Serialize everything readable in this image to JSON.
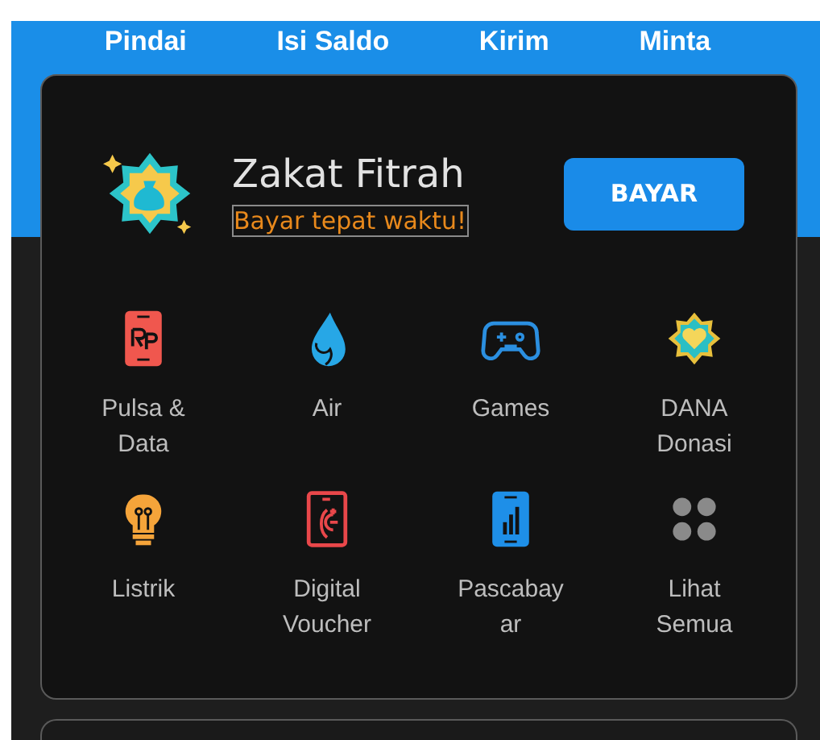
{
  "top_actions": [
    "Pindai",
    "Isi Saldo",
    "Kirim",
    "Minta"
  ],
  "promo": {
    "title": "Zakat Fitrah",
    "subtitle": "Bayar tepat waktu!",
    "button": "BAYAR"
  },
  "services": [
    {
      "label": "Pulsa &\nData"
    },
    {
      "label": "Air"
    },
    {
      "label": "Games"
    },
    {
      "label": "DANA\nDonasi"
    },
    {
      "label": "Listrik"
    },
    {
      "label": "Digital\nVoucher"
    },
    {
      "label": "Pascabay\nar"
    },
    {
      "label": "Lihat\nSemua"
    }
  ]
}
